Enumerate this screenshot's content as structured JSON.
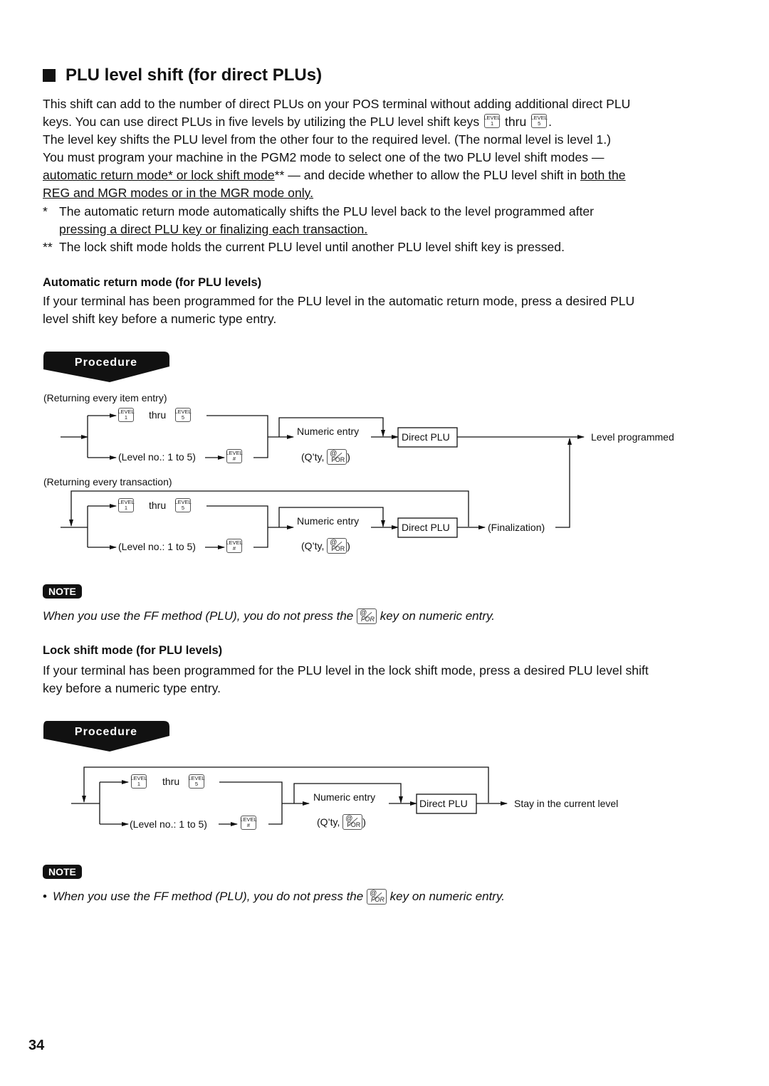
{
  "section": {
    "title": "PLU level shift (for direct PLUs)",
    "intro_lines": [
      "This shift can add to the number of direct PLUs on your POS terminal without adding additional direct PLU",
      "keys. You can use direct PLUs in five levels by utilizing the PLU level shift keys",
      "thru",
      "The level key shifts the PLU level from the other four to the required level. (The normal level is level 1.)",
      "You must program your machine in the PGM2 mode to select one of the two PLU level shift modes —",
      "automatic return mode* or lock shift mode",
      "** — and decide whether to allow the PLU level shift in ",
      "both the",
      "REG and MGR modes or in the MGR mode only."
    ],
    "footnotes": [
      {
        "mark": "*",
        "line1": "The automatic return mode automatically shifts the PLU level back to the level programmed after",
        "line2": "pressing a direct PLU key or finalizing each transaction."
      },
      {
        "mark": "**",
        "line1": "The lock shift mode holds the current PLU level until another PLU level shift key is pressed."
      }
    ]
  },
  "keys": {
    "level_word": "LEVEL",
    "level_1": "1",
    "level_5": "5",
    "level_hash": "#",
    "for_at": "@",
    "for_label": "FOR"
  },
  "auto_return": {
    "heading": "Automatic return mode (for PLU levels)",
    "body_line1": "If your terminal has been programmed for the PLU level in the automatic return mode, press a desired PLU",
    "body_line2": "level shift key before a numeric type entry.",
    "procedure_label": "Procedure",
    "diagram1": {
      "caption": "(Returning every item entry)",
      "thru": "thru",
      "level_no": "(Level no.: 1 to 5)",
      "numeric_entry": "Numeric entry",
      "qty": "(Q’ty,",
      "qty_close": ")",
      "direct_plu": "Direct PLU",
      "result": "Level programmed"
    },
    "diagram2": {
      "caption": "(Returning every transaction)",
      "thru": "thru",
      "level_no": "(Level no.: 1 to 5)",
      "numeric_entry": "Numeric entry",
      "qty": "(Q’ty,",
      "qty_close": ")",
      "direct_plu": "Direct PLU",
      "finalization": "(Finalization)"
    },
    "note_label": "NOTE",
    "note_pre": "When you use the FF method (PLU), you do not press the",
    "note_post": "key on numeric entry."
  },
  "lock_shift": {
    "heading": "Lock shift mode (for PLU levels)",
    "body_line1": "If your terminal has been programmed for the PLU level in the lock shift mode, press a desired PLU level shift",
    "body_line2": "key before a numeric type entry.",
    "procedure_label": "Procedure",
    "diagram": {
      "thru": "thru",
      "level_no": "(Level no.: 1 to 5)",
      "numeric_entry": "Numeric entry",
      "qty": "(Q’ty,",
      "qty_close": ")",
      "direct_plu": "Direct PLU",
      "result": "Stay in the current level"
    },
    "note_label": "NOTE",
    "note_bullet": "•",
    "note_pre": "When you use the FF method (PLU),  you do not press the",
    "note_post": "key on numeric entry."
  },
  "page_number": "34"
}
